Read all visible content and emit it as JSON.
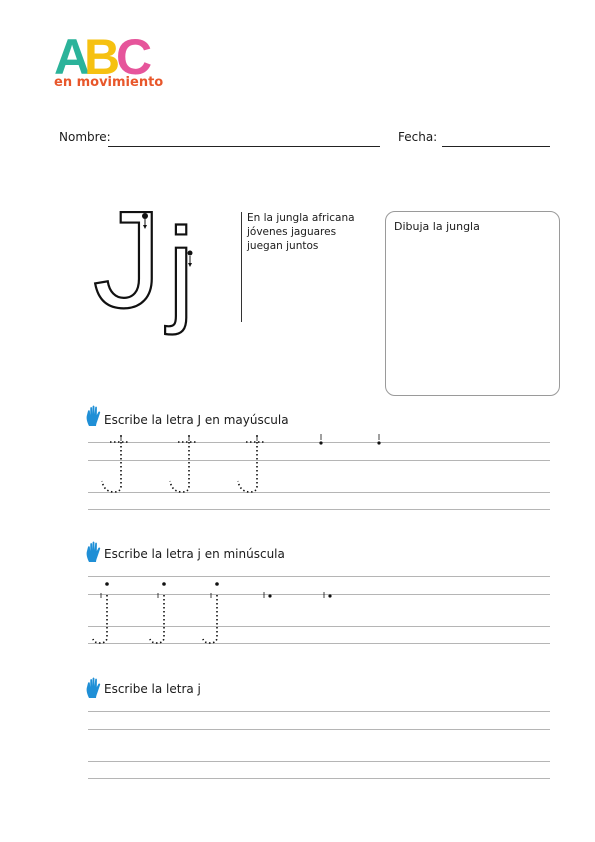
{
  "logo": {
    "letters": [
      "A",
      "B",
      "C"
    ],
    "subtitle": "en movimiento",
    "colors": {
      "A": "#2bb39a",
      "B": "#f6c111",
      "C": "#e6559b",
      "subtitle": "#e8572b"
    }
  },
  "header": {
    "name_label": "Nombre:",
    "date_label": "Fecha:"
  },
  "letter_display": {
    "uppercase": "J",
    "lowercase": "j"
  },
  "phrase_lines": [
    "En la jungla africana",
    "jóvenes jaguares",
    "juegan juntos"
  ],
  "drawing_box": {
    "label": "Dibuja la jungla"
  },
  "sections": [
    {
      "title": "Escribe la letra J en mayúscula",
      "icon": "hand-icon"
    },
    {
      "title": "Escribe la letra j en minúscula",
      "icon": "hand-icon"
    },
    {
      "title": "Escribe la letra j",
      "icon": "hand-icon"
    }
  ],
  "colors": {
    "hand": "#1f8fd6",
    "text": "#1a1a1a",
    "guide": "#b5b5b5"
  }
}
